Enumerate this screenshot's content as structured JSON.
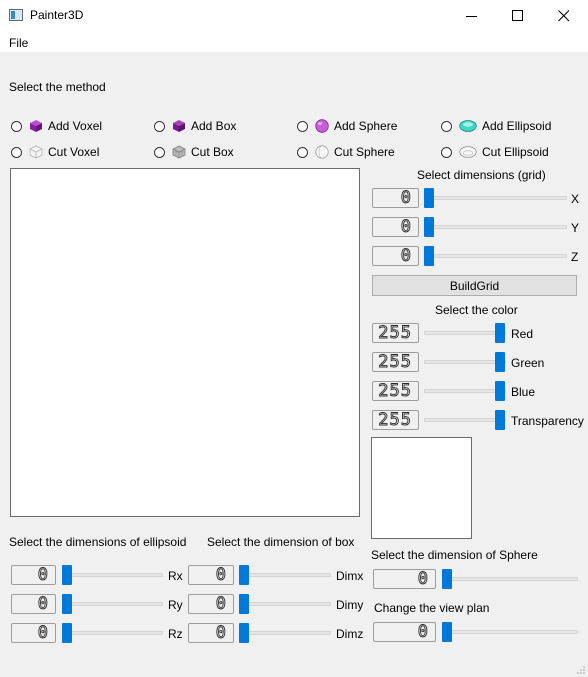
{
  "window": {
    "title": "Painter3D"
  },
  "menu": {
    "file": "File"
  },
  "method": {
    "heading": "Select the method",
    "options": [
      {
        "label": "Add Voxel",
        "icon": "voxel-purple-icon"
      },
      {
        "label": "Add Box",
        "icon": "box-purple-icon"
      },
      {
        "label": "Add Sphere",
        "icon": "sphere-purple-icon"
      },
      {
        "label": "Add Ellipsoid",
        "icon": "ellipsoid-teal-icon"
      },
      {
        "label": "Cut Voxel",
        "icon": "voxel-outline-icon"
      },
      {
        "label": "Cut Box",
        "icon": "box-grid-icon"
      },
      {
        "label": "Cut Sphere",
        "icon": "sphere-outline-icon"
      },
      {
        "label": "Cut Ellipsoid",
        "icon": "ellipsoid-outline-icon"
      }
    ]
  },
  "grid": {
    "heading": "Select dimensions (grid)",
    "axes": [
      {
        "label": "X",
        "value": "0"
      },
      {
        "label": "Y",
        "value": "0"
      },
      {
        "label": "Z",
        "value": "0"
      }
    ],
    "build_label": "BuildGrid"
  },
  "color": {
    "heading": "Select the color",
    "channels": [
      {
        "label": "Red",
        "value": "255",
        "level": 1
      },
      {
        "label": "Green",
        "value": "255",
        "level": 1
      },
      {
        "label": "Blue",
        "value": "255",
        "level": 1
      },
      {
        "label": "Transparency",
        "value": "255",
        "level": 1
      }
    ],
    "accent": "#0078d7"
  },
  "ellipsoid": {
    "heading": "Select the dimensions of ellipsoid",
    "params": [
      {
        "label": "Rx",
        "value": "0"
      },
      {
        "label": "Ry",
        "value": "0"
      },
      {
        "label": "Rz",
        "value": "0"
      }
    ]
  },
  "box": {
    "heading": "Select the dimension of box",
    "params": [
      {
        "label": "Dimx",
        "value": "0"
      },
      {
        "label": "Dimy",
        "value": "0"
      },
      {
        "label": "Dimz",
        "value": "0"
      }
    ]
  },
  "sphere": {
    "heading": "Select the dimension of Sphere",
    "value": "0"
  },
  "view": {
    "heading": "Change the view plan",
    "value": "0"
  }
}
